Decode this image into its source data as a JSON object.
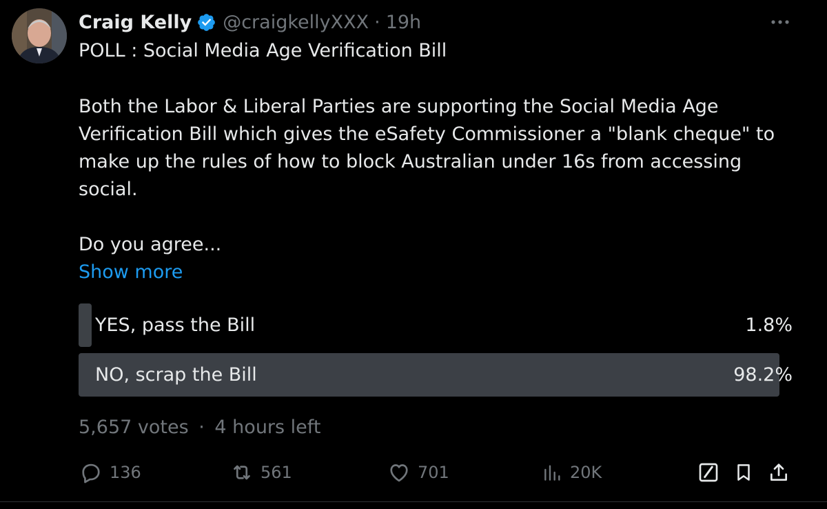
{
  "author": {
    "name": "Craig Kelly",
    "handle": "@craigkellyXXX",
    "time": "19h",
    "separator": "·"
  },
  "body": {
    "line1": "POLL : Social Media Age Verification Bill",
    "para2": [
      "Both the Labor & Liberal Parties are supporting the Social Media Age",
      "Verification Bill which gives the eSafety Commissioner a \"blank cheque\" to",
      "make up the rules of how to block Australian under 16s from accessing",
      "social."
    ],
    "line3": "Do you agree...",
    "show_more": "Show more"
  },
  "poll": {
    "options": [
      {
        "label": "YES, pass the Bill",
        "percent_text": "1.8%",
        "percent": 1.8
      },
      {
        "label": "NO, scrap the Bill",
        "percent_text": "98.2%",
        "percent": 98.2
      }
    ],
    "votes": "5,657 votes",
    "separator": "·",
    "time_left": "4 hours left"
  },
  "actions": {
    "replies": "136",
    "reposts": "561",
    "likes": "701",
    "views": "20K"
  },
  "icons": {
    "verified": "verified-badge-icon",
    "more": "more-dots-icon",
    "reply": "reply-icon",
    "repost": "repost-icon",
    "like": "heart-icon",
    "views": "views-chart-icon",
    "grok": "grok-icon",
    "bookmark": "bookmark-icon",
    "share": "share-icon"
  },
  "colors": {
    "background": "#000000",
    "text": "#e7e9ea",
    "muted": "#71767b",
    "link": "#1d9bf0",
    "verified": "#1d9bf0",
    "poll_bar": "#3c4046"
  }
}
